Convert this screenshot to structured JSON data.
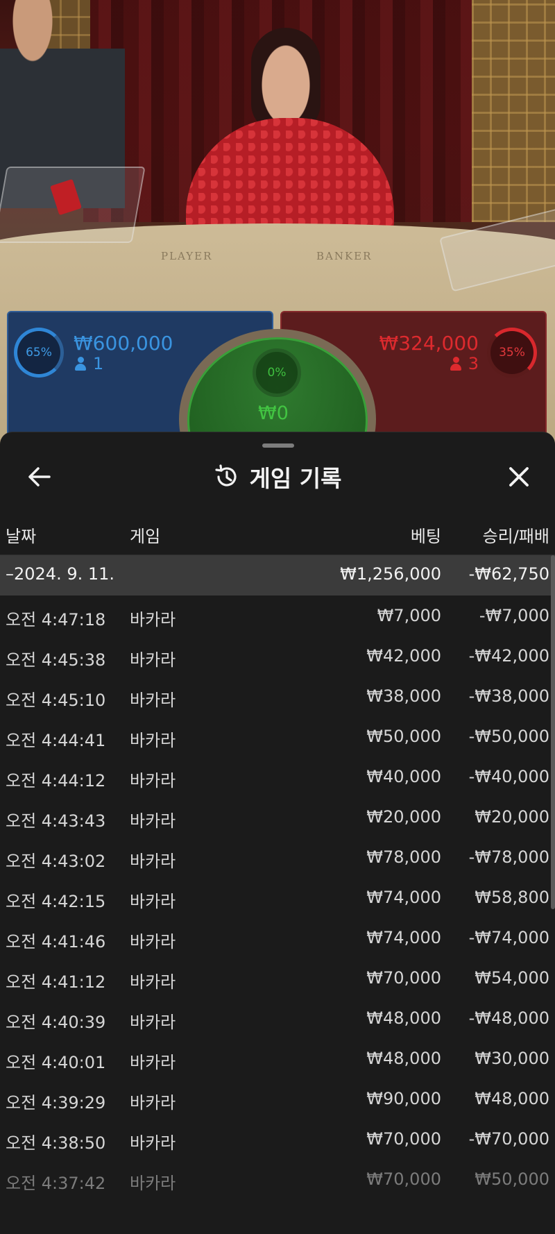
{
  "video": {
    "felt_player_label": "PLAYER",
    "felt_banker_label": "BANKER"
  },
  "bets": {
    "player": {
      "percent": "65%",
      "amount": "₩600,000",
      "count": "1",
      "color": "#3a94e0"
    },
    "tie": {
      "percent": "0%",
      "amount": "₩0",
      "color": "#42c442"
    },
    "banker": {
      "percent": "35%",
      "amount": "₩324,000",
      "count": "3",
      "color": "#dd2a2e"
    }
  },
  "sheet": {
    "title": "게임 기록",
    "icons": {
      "back": "arrow-left-icon",
      "history": "history-icon",
      "close": "close-icon"
    },
    "columns": {
      "date": "날짜",
      "game": "게임",
      "bet": "베팅",
      "result": "승리/패배"
    },
    "summary": {
      "date": "–2024. 9. 11.",
      "bet": "₩1,256,000",
      "result": "-₩62,750"
    },
    "rows": [
      {
        "time": "오전 4:47:18",
        "game": "바카라",
        "bet": "₩7,000",
        "result": "-₩7,000"
      },
      {
        "time": "오전 4:45:38",
        "game": "바카라",
        "bet": "₩42,000",
        "result": "-₩42,000"
      },
      {
        "time": "오전 4:45:10",
        "game": "바카라",
        "bet": "₩38,000",
        "result": "-₩38,000"
      },
      {
        "time": "오전 4:44:41",
        "game": "바카라",
        "bet": "₩50,000",
        "result": "-₩50,000"
      },
      {
        "time": "오전 4:44:12",
        "game": "바카라",
        "bet": "₩40,000",
        "result": "-₩40,000"
      },
      {
        "time": "오전 4:43:43",
        "game": "바카라",
        "bet": "₩20,000",
        "result": "₩20,000"
      },
      {
        "time": "오전 4:43:02",
        "game": "바카라",
        "bet": "₩78,000",
        "result": "-₩78,000"
      },
      {
        "time": "오전 4:42:15",
        "game": "바카라",
        "bet": "₩74,000",
        "result": "₩58,800"
      },
      {
        "time": "오전 4:41:46",
        "game": "바카라",
        "bet": "₩74,000",
        "result": "-₩74,000"
      },
      {
        "time": "오전 4:41:12",
        "game": "바카라",
        "bet": "₩70,000",
        "result": "₩54,000"
      },
      {
        "time": "오전 4:40:39",
        "game": "바카라",
        "bet": "₩48,000",
        "result": "-₩48,000"
      },
      {
        "time": "오전 4:40:01",
        "game": "바카라",
        "bet": "₩48,000",
        "result": "₩30,000"
      },
      {
        "time": "오전 4:39:29",
        "game": "바카라",
        "bet": "₩90,000",
        "result": "₩48,000"
      },
      {
        "time": "오전 4:38:50",
        "game": "바카라",
        "bet": "₩70,000",
        "result": "-₩70,000"
      },
      {
        "time": "오전 4:37:42",
        "game": "바카라",
        "bet": "₩70,000",
        "result": "₩50,000"
      }
    ]
  }
}
